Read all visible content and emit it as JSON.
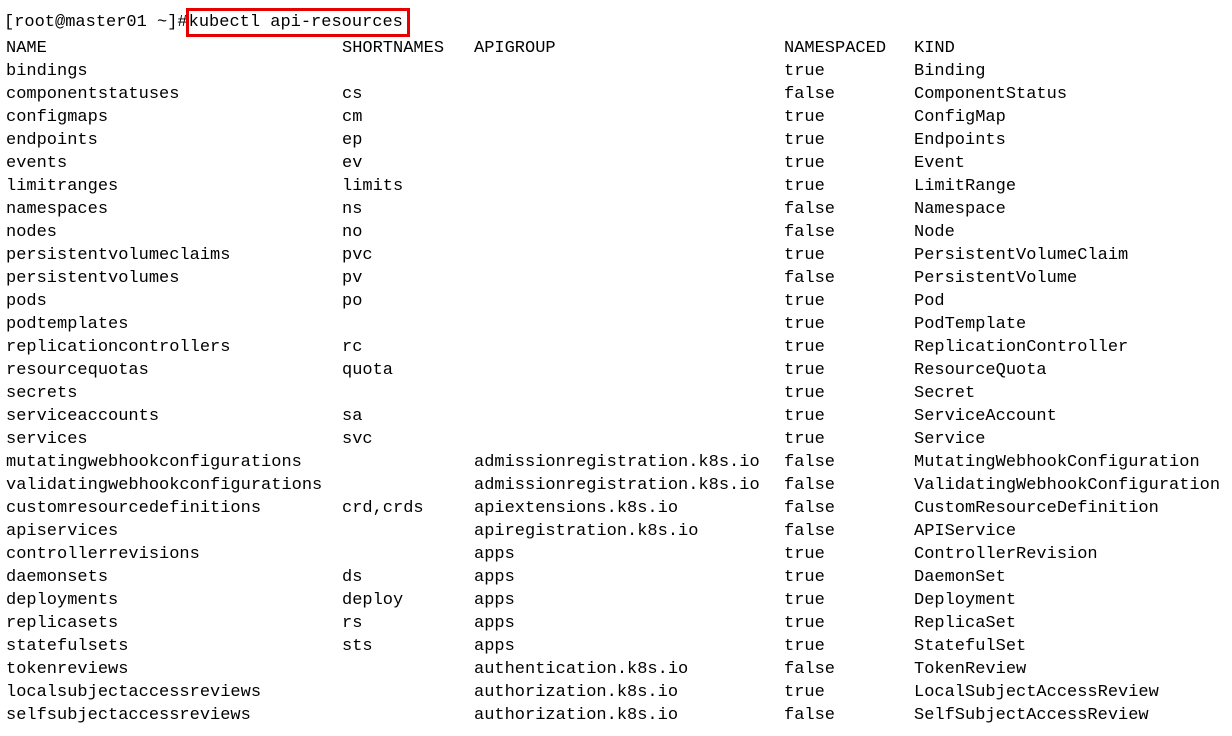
{
  "prompt_prefix": "[root@master01 ~]#",
  "command": " kubectl api-resources",
  "headers": {
    "name": "NAME",
    "short": "SHORTNAMES",
    "apigroup": "APIGROUP",
    "ns": "NAMESPACED",
    "kind": "KIND"
  },
  "rows": [
    {
      "name": "bindings",
      "short": "",
      "apigroup": "",
      "ns": "true",
      "kind": "Binding"
    },
    {
      "name": "componentstatuses",
      "short": "cs",
      "apigroup": "",
      "ns": "false",
      "kind": "ComponentStatus"
    },
    {
      "name": "configmaps",
      "short": "cm",
      "apigroup": "",
      "ns": "true",
      "kind": "ConfigMap"
    },
    {
      "name": "endpoints",
      "short": "ep",
      "apigroup": "",
      "ns": "true",
      "kind": "Endpoints"
    },
    {
      "name": "events",
      "short": "ev",
      "apigroup": "",
      "ns": "true",
      "kind": "Event"
    },
    {
      "name": "limitranges",
      "short": "limits",
      "apigroup": "",
      "ns": "true",
      "kind": "LimitRange"
    },
    {
      "name": "namespaces",
      "short": "ns",
      "apigroup": "",
      "ns": "false",
      "kind": "Namespace"
    },
    {
      "name": "nodes",
      "short": "no",
      "apigroup": "",
      "ns": "false",
      "kind": "Node"
    },
    {
      "name": "persistentvolumeclaims",
      "short": "pvc",
      "apigroup": "",
      "ns": "true",
      "kind": "PersistentVolumeClaim"
    },
    {
      "name": "persistentvolumes",
      "short": "pv",
      "apigroup": "",
      "ns": "false",
      "kind": "PersistentVolume"
    },
    {
      "name": "pods",
      "short": "po",
      "apigroup": "",
      "ns": "true",
      "kind": "Pod"
    },
    {
      "name": "podtemplates",
      "short": "",
      "apigroup": "",
      "ns": "true",
      "kind": "PodTemplate"
    },
    {
      "name": "replicationcontrollers",
      "short": "rc",
      "apigroup": "",
      "ns": "true",
      "kind": "ReplicationController"
    },
    {
      "name": "resourcequotas",
      "short": "quota",
      "apigroup": "",
      "ns": "true",
      "kind": "ResourceQuota"
    },
    {
      "name": "secrets",
      "short": "",
      "apigroup": "",
      "ns": "true",
      "kind": "Secret"
    },
    {
      "name": "serviceaccounts",
      "short": "sa",
      "apigroup": "",
      "ns": "true",
      "kind": "ServiceAccount"
    },
    {
      "name": "services",
      "short": "svc",
      "apigroup": "",
      "ns": "true",
      "kind": "Service"
    },
    {
      "name": "mutatingwebhookconfigurations",
      "short": "",
      "apigroup": "admissionregistration.k8s.io",
      "ns": "false",
      "kind": "MutatingWebhookConfiguration"
    },
    {
      "name": "validatingwebhookconfigurations",
      "short": "",
      "apigroup": "admissionregistration.k8s.io",
      "ns": "false",
      "kind": "ValidatingWebhookConfiguration"
    },
    {
      "name": "customresourcedefinitions",
      "short": "crd,crds",
      "apigroup": "apiextensions.k8s.io",
      "ns": "false",
      "kind": "CustomResourceDefinition"
    },
    {
      "name": "apiservices",
      "short": "",
      "apigroup": "apiregistration.k8s.io",
      "ns": "false",
      "kind": "APIService"
    },
    {
      "name": "controllerrevisions",
      "short": "",
      "apigroup": "apps",
      "ns": "true",
      "kind": "ControllerRevision"
    },
    {
      "name": "daemonsets",
      "short": "ds",
      "apigroup": "apps",
      "ns": "true",
      "kind": "DaemonSet"
    },
    {
      "name": "deployments",
      "short": "deploy",
      "apigroup": "apps",
      "ns": "true",
      "kind": "Deployment"
    },
    {
      "name": "replicasets",
      "short": "rs",
      "apigroup": "apps",
      "ns": "true",
      "kind": "ReplicaSet"
    },
    {
      "name": "statefulsets",
      "short": "sts",
      "apigroup": "apps",
      "ns": "true",
      "kind": "StatefulSet"
    },
    {
      "name": "tokenreviews",
      "short": "",
      "apigroup": "authentication.k8s.io",
      "ns": "false",
      "kind": "TokenReview"
    },
    {
      "name": "localsubjectaccessreviews",
      "short": "",
      "apigroup": "authorization.k8s.io",
      "ns": "true",
      "kind": "LocalSubjectAccessReview"
    },
    {
      "name": "selfsubjectaccessreviews",
      "short": "",
      "apigroup": "authorization.k8s.io",
      "ns": "false",
      "kind": "SelfSubjectAccessReview"
    }
  ]
}
